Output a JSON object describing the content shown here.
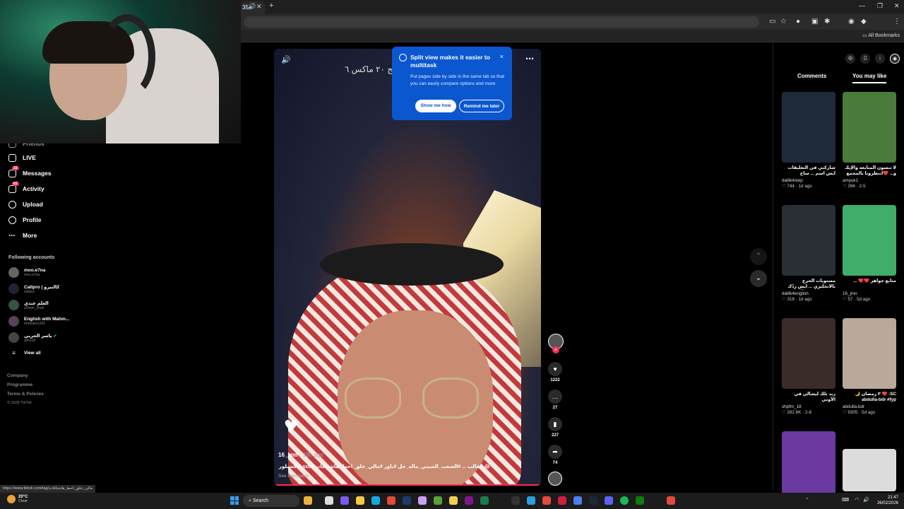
{
  "browser": {
    "tab_count_label": "35",
    "new_tab": "+",
    "bookmarks_label": "All Bookmarks"
  },
  "nav": {
    "items": [
      {
        "label": "Friends",
        "icon": "friends-icon"
      },
      {
        "label": "LIVE",
        "icon": "live-icon"
      },
      {
        "label": "Messages",
        "icon": "messages-icon",
        "badge": "23"
      },
      {
        "label": "Activity",
        "icon": "activity-icon",
        "badge": "63"
      },
      {
        "label": "Upload",
        "icon": "upload-icon"
      },
      {
        "label": "Profile",
        "icon": "profile-icon"
      },
      {
        "label": "More",
        "icon": "more-icon"
      }
    ],
    "following_label": "Following accounts",
    "accounts": [
      {
        "name": "moo.e7na",
        "handle": "moo.e7na"
      },
      {
        "name": "Caltpro | كالتبرو",
        "handle": "caltpro"
      },
      {
        "name": "العلم عندي",
        "handle": "el3elm_3indi"
      },
      {
        "name": "English with Mahm...",
        "handle": "mrbeans1191"
      },
      {
        "name": "ياسر الحربي",
        "handle": "ybh100"
      }
    ],
    "view_all": "View all",
    "footer": [
      "Company",
      "Programme",
      "Terms & Policies",
      "© 2026 TikTok"
    ]
  },
  "video": {
    "title": "مقا... ـقه فاوندر برستيج ٢٠ ماكس ٦",
    "author": "16_jmn",
    "time": "· 19h ago",
    "caption": "😂 مقالب ... #الشعب_الصيني_ماله_حل #باور #مالي_خلق_احط_هاشتاقات #sxb #اكسبلور #",
    "see_translation": "See translation",
    "progress_fraction": 1.0
  },
  "actions": {
    "likes": "1222",
    "comments": "27",
    "saves": "227",
    "shares": "74"
  },
  "popup": {
    "title": "Split view makes it easier to multitask",
    "body": "Put pages side by side in the same tab so that you can easily compare options and more",
    "show_me_how": "Show me how",
    "remind_later": "Remind me later",
    "close": "×"
  },
  "right_panel": {
    "tabs": [
      "Comments",
      "You may like"
    ],
    "cards": [
      {
        "title": "شاركني في التعليقات ايش اسم ... ساح ستوريك؟ 😂 فلسطين",
        "user": "dalilk4step",
        "stats": "♡ 744 · 1d ago",
        "color": "#1f2a3a"
      },
      {
        "title": "لا تنسون المتابعة والإيك و... ❤️انتظرونا بالمجمع",
        "user": "amyuk1",
        "stats": "♡ 266 · 2-5",
        "color": "#4a7b3a"
      },
      {
        "title": "مستويات الحرج بالانجليزي ... ايش ردّك بالعطف على الآخر؟",
        "user": "dalilk4english",
        "stats": "♡ 318 · 1d ago",
        "color": "#2a2f35"
      },
      {
        "title": "متابع جواهر ❤️❤️ ...",
        "user": "16_jmn",
        "stats": "♡ 57 · 5d ago",
        "color": "#3fae6a"
      },
      {
        "title": "زبد تلك ليشالي في الأوتي #زبدي_خل_اهلي_فرزن",
        "user": "shpfm_18",
        "stats": "♡ 282.6K · 2-8",
        "color": "#3a2c28"
      },
      {
        "title": "SC: ❤️ ٣ رمضان 🌙 abdulla-bdr #fyp",
        "user": "abdulla.bdr",
        "stats": "♡ 9305 · 5d ago",
        "color": "#b8a99a"
      },
      {
        "title": "",
        "user": "",
        "stats": "",
        "color": "#6a3aa0"
      },
      {
        "title": "",
        "user": "",
        "stats": "",
        "color": "#dcdcdc"
      }
    ]
  },
  "status_url": "https://www.tiktok.com/tag/مالي_خلق_احط_هاشتاقات",
  "taskbar": {
    "weather_temp": "20°C",
    "weather_desc": "Clear",
    "search": "Search",
    "time": "21:47",
    "date": "26/02/2026"
  },
  "colors": {
    "accent_pink": "#fe2c55",
    "popup_blue": "#0b57d0"
  }
}
